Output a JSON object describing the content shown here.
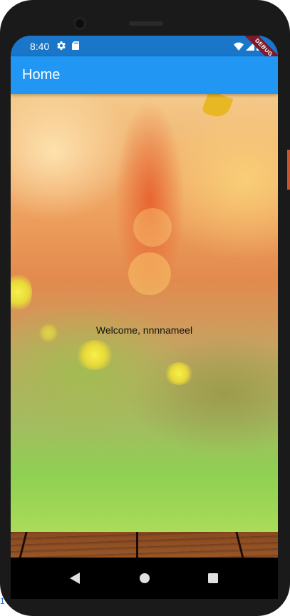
{
  "status_bar": {
    "time": "8:40",
    "debug_banner": "DEBUG",
    "icons": [
      "gear-icon",
      "sd-card-icon",
      "wifi-icon",
      "signal-icon",
      "battery-icon"
    ]
  },
  "app_bar": {
    "title": "Home",
    "color": "#2196f3"
  },
  "content": {
    "welcome_text": "Welcome, nnnnameel"
  },
  "navigation_bar": {
    "icons": [
      "back-icon",
      "home-icon",
      "recents-icon"
    ]
  },
  "colors": {
    "status_bar": "#1976c8",
    "app_bar": "#2196f3",
    "debug_ribbon": "#7a1b2d"
  },
  "side_marker": "1"
}
